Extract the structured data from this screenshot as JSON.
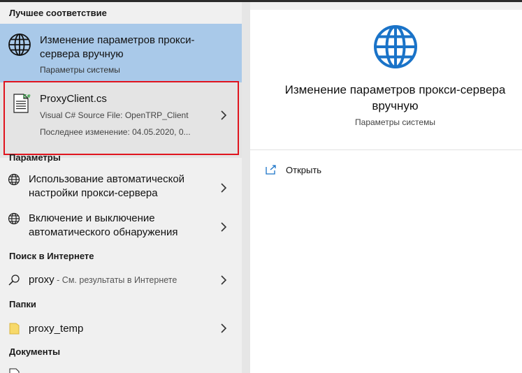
{
  "sections": {
    "best_match": "Лучшее соответствие",
    "settings": "Параметры",
    "web_search": "Поиск в Интернете",
    "folders": "Папки",
    "documents": "Документы"
  },
  "best_match": {
    "title": "Изменение параметров прокси-сервера вручную",
    "subtitle": "Параметры системы",
    "icon": "globe-icon"
  },
  "file_result": {
    "title": "ProxyClient.cs",
    "type_line": "Visual C# Source File: OpenTRP_Client",
    "modified_line": "Последнее изменение: 04.05.2020, 0...",
    "icon": "csharp-file-icon"
  },
  "settings_items": [
    {
      "label": "Использование автоматической настройки прокси-сервера",
      "icon": "globe-icon"
    },
    {
      "label": "Включение и выключение автоматического обнаружения",
      "icon": "globe-icon"
    }
  ],
  "web_item": {
    "query": "proxy",
    "hint": " - См. результаты в Интернете",
    "icon": "search-icon"
  },
  "folder_item": {
    "label": "proxy_temp",
    "icon": "folder-icon"
  },
  "preview": {
    "title": "Изменение параметров прокси-сервера вручную",
    "subtitle": "Параметры системы",
    "open_label": "Открыть"
  },
  "colors": {
    "selection": "#a9c9e9",
    "accent": "#1a73c8",
    "highlight_border": "#e0141e"
  }
}
